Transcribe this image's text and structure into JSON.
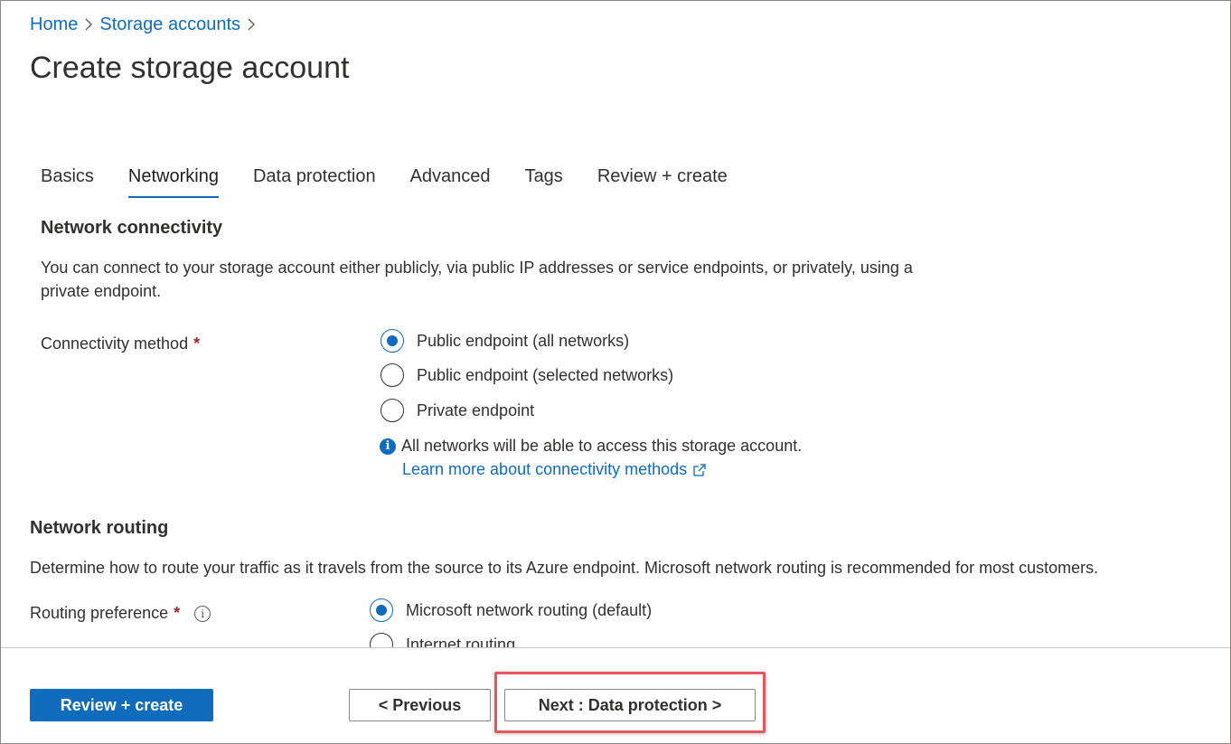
{
  "breadcrumb": {
    "items": [
      "Home",
      "Storage accounts"
    ]
  },
  "page": {
    "title": "Create storage account"
  },
  "tabs": [
    {
      "label": "Basics",
      "active": false
    },
    {
      "label": "Networking",
      "active": true
    },
    {
      "label": "Data protection",
      "active": false
    },
    {
      "label": "Advanced",
      "active": false
    },
    {
      "label": "Tags",
      "active": false
    },
    {
      "label": "Review + create",
      "active": false
    }
  ],
  "network_connectivity": {
    "heading": "Network connectivity",
    "description_line1": "You can connect to your storage account either publicly, via public IP addresses or service endpoints, or privately, using a",
    "description_line2": "private endpoint.",
    "connectivity_label": "Connectivity method",
    "required_mark": "*",
    "options": [
      {
        "label": "Public endpoint (all networks)",
        "selected": true
      },
      {
        "label": "Public endpoint (selected networks)",
        "selected": false
      },
      {
        "label": "Private endpoint",
        "selected": false
      }
    ],
    "info_text": "All networks will be able to access this storage account.",
    "learn_more": "Learn more about connectivity methods"
  },
  "network_routing": {
    "heading": "Network routing",
    "description": "Determine how to route your traffic as it travels from the source to its Azure endpoint. Microsoft network routing is recommended for most customers.",
    "routing_label": "Routing preference",
    "required_mark": "*",
    "options": [
      {
        "label": "Microsoft network routing (default)",
        "selected": true
      },
      {
        "label": "Internet routing",
        "selected": false
      }
    ]
  },
  "footer": {
    "review_create": "Review + create",
    "previous": "< Previous",
    "next": "Next : Data protection >"
  },
  "colors": {
    "accent": "#0f6cbd",
    "required": "#a4262c",
    "highlight": "#e8555e"
  }
}
